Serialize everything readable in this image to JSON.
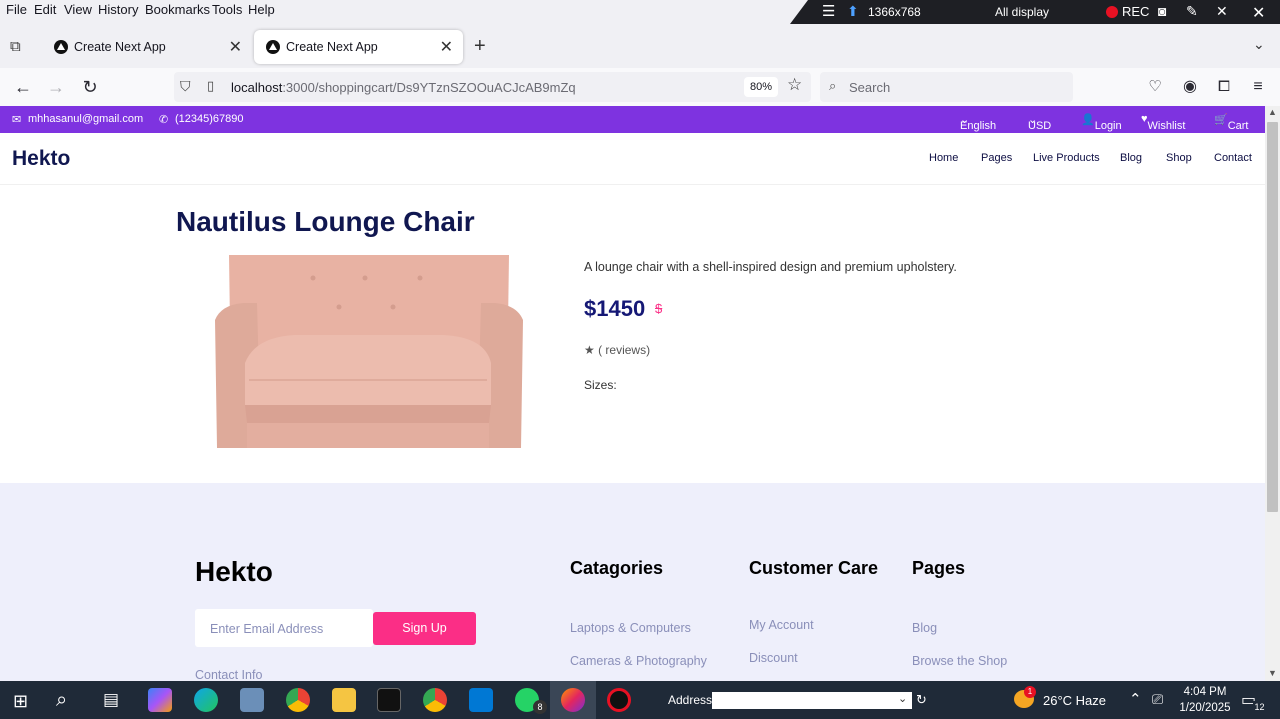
{
  "menubar": {
    "items": [
      "File",
      "Edit",
      "View",
      "History",
      "Bookmarks",
      "Tools",
      "Help"
    ]
  },
  "recorder": {
    "resolution": "1366x768",
    "display": "All display",
    "rec_label": "REC"
  },
  "tabs": [
    {
      "title": "Create Next App",
      "active": false
    },
    {
      "title": "Create Next App",
      "active": true
    }
  ],
  "navbar": {
    "url_host": "localhost",
    "url_path": ":3000/shoppingcart/Ds9YTznSZOOuACJcAB9mZq",
    "zoom": "80%",
    "search_placeholder": "Search"
  },
  "site": {
    "topbar": {
      "email": "mhhasanul@gmail.com",
      "phone": "(12345)67890",
      "language": "English",
      "currency": "USD",
      "login": "Login",
      "wishlist": "Wishlist",
      "cart": "Cart"
    },
    "header": {
      "logo": "Hekto",
      "nav": [
        "Home",
        "Pages",
        "Live Products",
        "Blog",
        "Shop",
        "Contact"
      ]
    },
    "product": {
      "title": "Nautilus Lounge Chair",
      "description": "A lounge chair with a shell-inspired design and premium upholstery.",
      "price": "$1450",
      "old_price": "$",
      "rating": "★ ( reviews)",
      "sizes_label": "Sizes:"
    },
    "footer": {
      "logo": "Hekto",
      "email_placeholder": "Enter Email Address",
      "signup": "Sign Up",
      "contact": "Contact Info",
      "categories_title": "Catagories",
      "categories": [
        "Laptops & Computers",
        "Cameras & Photography"
      ],
      "care_title": "Customer Care",
      "care": [
        "My Account",
        "Discount"
      ],
      "pages_title": "Pages",
      "pages": [
        "Blog",
        "Browse the Shop"
      ]
    }
  },
  "taskbar": {
    "address_label": "Address",
    "whatsapp_badge": "8",
    "weather": "26°C  Haze",
    "time": "4:04 PM",
    "date": "1/20/2025",
    "notifications": "12",
    "weather_badge": "1"
  },
  "colors": {
    "topbar": "#7e33e0",
    "accent_pink": "#fb2e86",
    "navy": "#101750",
    "footer_bg": "#eeeffb"
  }
}
